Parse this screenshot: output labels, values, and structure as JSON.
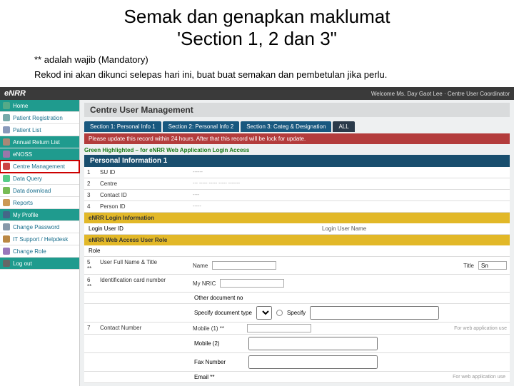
{
  "slide": {
    "title_line1": "Semak dan genapkan maklumat",
    "title_line2": "'Section 1, 2 dan 3\"",
    "sub1": "** adalah wajib (Mandatory)",
    "sub2": "Rekod ini akan dikunci selepas hari ini, buat buat semakan dan pembetulan jika perlu."
  },
  "topbar": {
    "logo_e": "e",
    "logo_rest": "NRR",
    "welcome": "Welcome Ms. Day Gaot Lee · Centre User Coordinator"
  },
  "sidebar": [
    {
      "label": "Home"
    },
    {
      "label": "Patient Registration"
    },
    {
      "label": "Patient List"
    },
    {
      "label": "Annual Return List"
    },
    {
      "label": "eNOSS"
    },
    {
      "label": "Centre Management"
    },
    {
      "label": "Data Query"
    },
    {
      "label": "Data download"
    },
    {
      "label": "Reports"
    },
    {
      "label": "My Profile"
    },
    {
      "label": "Change Password"
    },
    {
      "label": "IT Support / Helpdesk"
    },
    {
      "label": "Change Role"
    },
    {
      "label": "Log out"
    }
  ],
  "page": {
    "title": "Centre User Management",
    "tabs": [
      "Section 1: Personal Info 1",
      "Section 2: Personal Info 2",
      "Section 3: Categ & Designation",
      "ALL"
    ],
    "alert": "Please update this record within 24 hours. After that this record will be lock for update.",
    "highlight": "Green Highlighted – for eNRR Web Application Login Access",
    "section_header": "Personal Information 1",
    "rows": {
      "r1_num": "1",
      "r1_label": "SU ID",
      "r2_num": "2",
      "r2_label": "Centre",
      "r3_num": "3",
      "r3_label": "Contact ID",
      "r4_num": "4",
      "r4_label": "Person ID"
    },
    "login_band": "eNRR Login Information",
    "login_user_id_label": "Login User ID",
    "login_user_name_label": "Login User Name",
    "role_band": "eNRR Web Access User Role",
    "role_label": "Role",
    "r5_num": "5 **",
    "r5_label": "User Full Name & Title",
    "name_label": "Name",
    "title_label": "Title",
    "title_value": "Sn",
    "r6_num": "6 **",
    "r6_label": "Identification card number",
    "nric_label": "My NRIC",
    "other_doc_label": "Other document no",
    "spec_doc_label": "Specify document type",
    "specify_btn": "Specify",
    "r7_num": "7",
    "r7_label": "Contact Number",
    "mobile1_label": "Mobile (1) **",
    "mobile1_note": "For web application use",
    "mobile2_label": "Mobile (2)",
    "fax_label": "Fax Number",
    "email_label": "Email **",
    "email_note": "For web application use"
  }
}
